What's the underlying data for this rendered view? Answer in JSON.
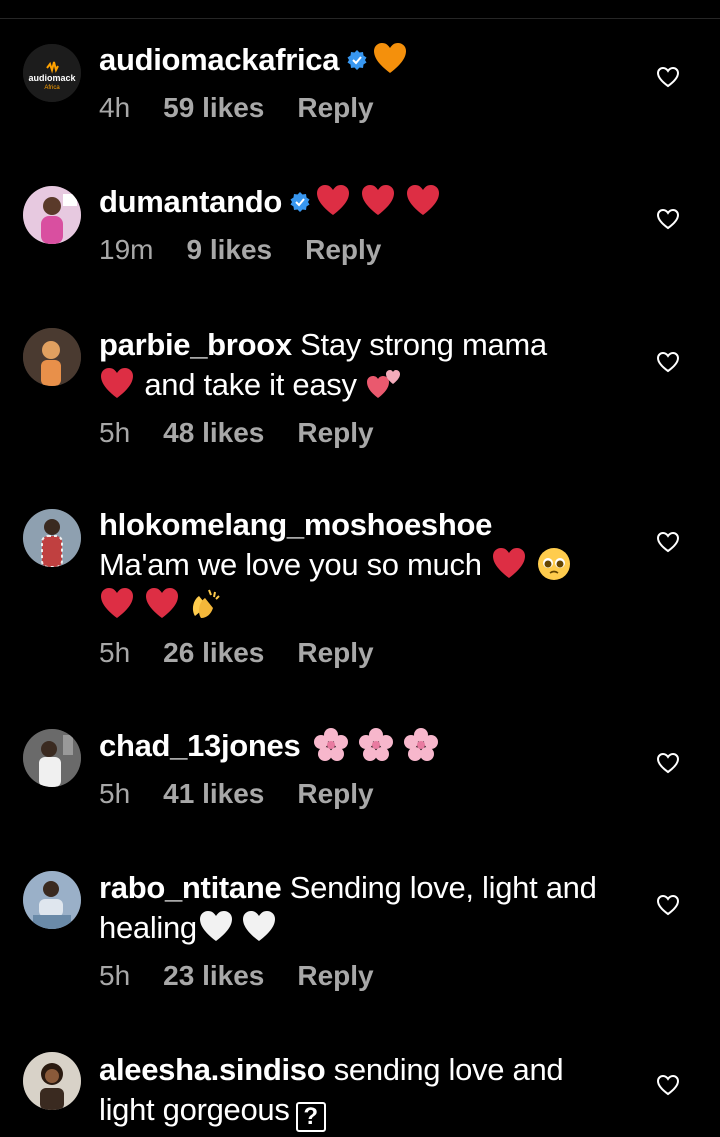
{
  "comments": [
    {
      "username": "audiomackafrica",
      "verified": true,
      "text": "",
      "emojis": [
        "orange-heart"
      ],
      "time": "4h",
      "likes": "59 likes",
      "reply": "Reply",
      "avatar_label": "audiomack",
      "avatar_sublabel": "Africa"
    },
    {
      "username": "dumantando",
      "verified": true,
      "text": "",
      "emojis": [
        "red-heart",
        "red-heart",
        "red-heart"
      ],
      "time": "19m",
      "likes": "9 likes",
      "reply": "Reply"
    },
    {
      "username": "parbie_broox",
      "verified": false,
      "text_a": "Stay strong mama",
      "text_b": "and take it easy",
      "time": "5h",
      "likes": "48 likes",
      "reply": "Reply"
    },
    {
      "username": "hlokomelang_moshoeshoe",
      "verified": false,
      "text": "Ma'am we love you so much",
      "time": "5h",
      "likes": "26 likes",
      "reply": "Reply"
    },
    {
      "username": "chad_13jones",
      "verified": false,
      "text": "",
      "emojis": [
        "cherry-blossom",
        "cherry-blossom",
        "cherry-blossom"
      ],
      "time": "5h",
      "likes": "41 likes",
      "reply": "Reply"
    },
    {
      "username": "rabo_ntitane",
      "verified": false,
      "text": "Sending love, light and healing",
      "time": "5h",
      "likes": "23 likes",
      "reply": "Reply"
    },
    {
      "username": "aleesha.sindiso",
      "verified": false,
      "text": "sending love and light gorgeous",
      "unknown_glyph": "?"
    }
  ],
  "colors": {
    "background": "#000000",
    "text": "#ffffff",
    "meta": "#a8a8a8",
    "verified": "#3897f0"
  }
}
